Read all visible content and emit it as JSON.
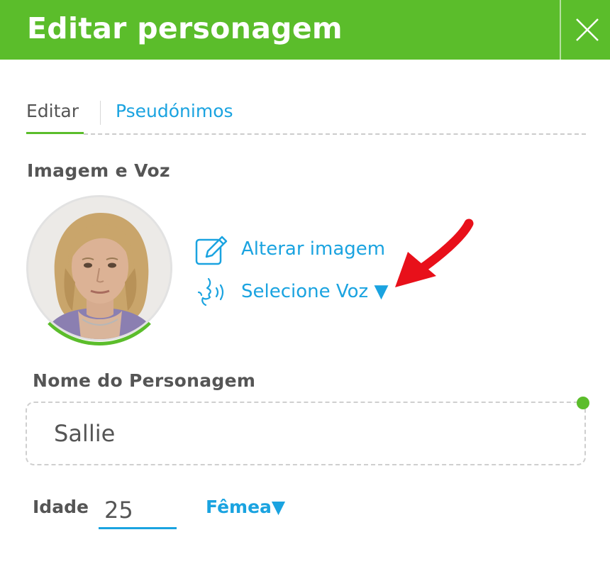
{
  "header": {
    "title": "Editar personagem",
    "close_icon": "close-icon"
  },
  "tabs": [
    {
      "label": "Editar",
      "active": true
    },
    {
      "label": "Pseudónimos",
      "active": false
    }
  ],
  "image_voice": {
    "section_label": "Imagem e Voz",
    "change_image_label": "Alterar imagem",
    "change_image_icon": "edit-icon",
    "select_voice_label": "Selecione Voz ▼",
    "select_voice_icon": "voice-icon"
  },
  "name_field": {
    "label": "Nome do Personagem",
    "value": "Sallie"
  },
  "age_field": {
    "label": "Idade",
    "value": "25"
  },
  "gender_select": {
    "selected": "Fêmea▼"
  },
  "colors": {
    "brand_green": "#5bbd2b",
    "link_blue": "#1aa3e0",
    "annotation_red": "#e8101a"
  }
}
